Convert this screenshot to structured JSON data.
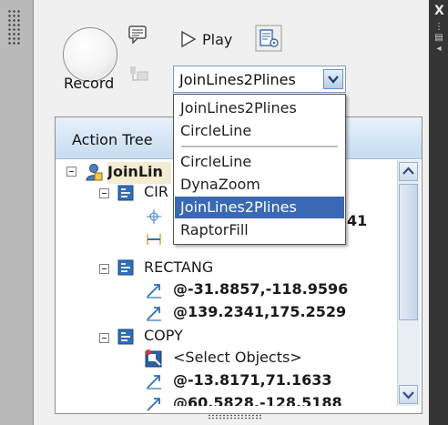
{
  "toolbar": {
    "record_label": "Record",
    "play_label": "Play",
    "macro_combo": {
      "value": "JoinLines2Plines",
      "options_recent": [
        "JoinLines2Plines",
        "CircleLine"
      ],
      "options_all": [
        "CircleLine",
        "DynaZoom",
        "JoinLines2Plines",
        "RaptorFill"
      ],
      "selected": "JoinLines2Plines"
    }
  },
  "tree": {
    "header": "Action Tree",
    "root_label": "JoinLin",
    "nodes": [
      {
        "label": "CIR",
        "type": "command"
      },
      {
        "label": "41",
        "type": "value-fragment"
      },
      {
        "label": "RECTANG",
        "type": "command"
      },
      {
        "label": "@-31.8857,-118.9596",
        "type": "coordinate"
      },
      {
        "label": "@139.2341,175.2529",
        "type": "coordinate"
      },
      {
        "label": "COPY",
        "type": "command"
      },
      {
        "label": "<Select Objects>",
        "type": "selection"
      },
      {
        "label": "@-13.8171,71.1633",
        "type": "coordinate"
      },
      {
        "label": "@60.5828,-128.5188",
        "type": "coordinate"
      }
    ]
  },
  "side": {
    "close_glyph": "X"
  },
  "colors": {
    "selection": "#3a68b4",
    "header_gradient_top": "#e6f1fb",
    "header_gradient_bottom": "#c8dcf0",
    "command_icon": "#2f6fb8",
    "coordinate_icon": "#2f6fb8"
  }
}
